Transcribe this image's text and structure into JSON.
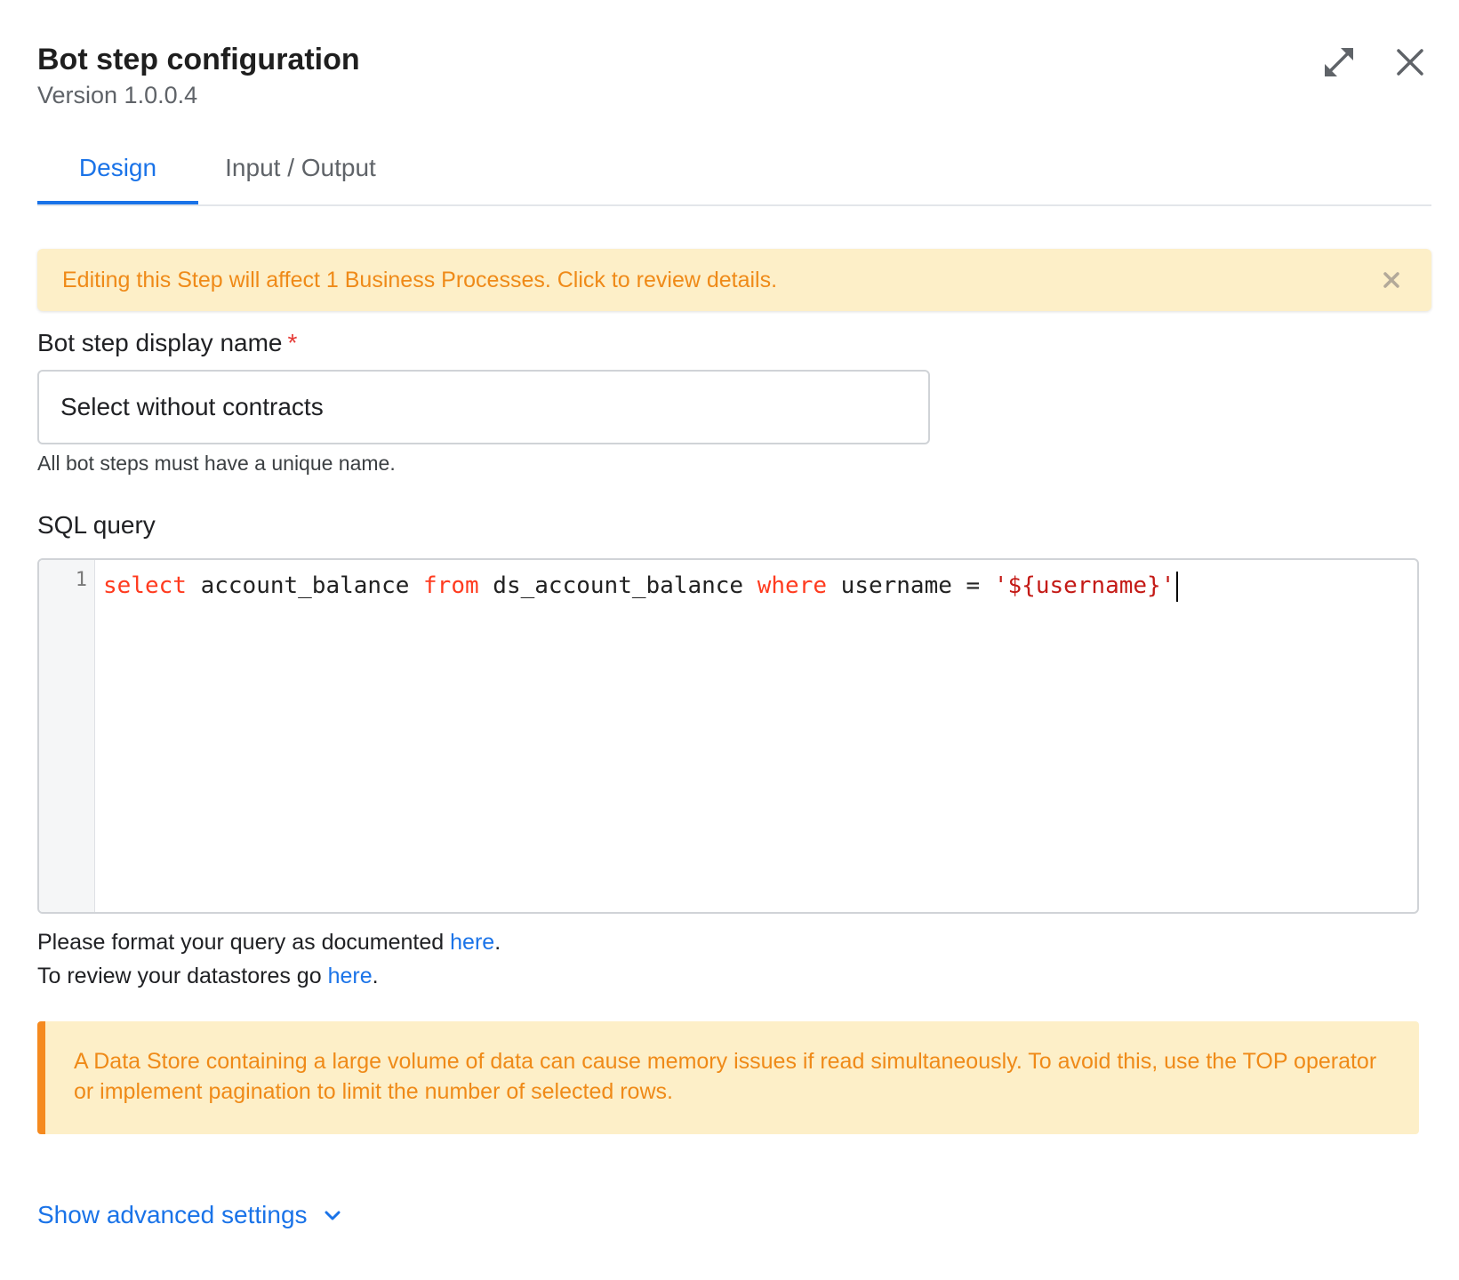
{
  "header": {
    "title": "Bot step configuration",
    "version": "Version 1.0.0.4",
    "expand_icon": "expand-icon",
    "close_icon": "close-icon"
  },
  "tabs": [
    {
      "label": "Design",
      "active": true
    },
    {
      "label": "Input / Output",
      "active": false
    }
  ],
  "top_alert": {
    "text": "Editing this Step will affect 1 Business Processes. Click to review details.",
    "close_icon": "close-icon"
  },
  "display_name": {
    "label": "Bot step display name",
    "required_marker": "*",
    "value": "Select without contracts",
    "hint": "All bot steps must have a unique name."
  },
  "sql": {
    "label": "SQL query",
    "line_number": "1",
    "tokens": {
      "kw_select": "select",
      "t1": " account_balance ",
      "kw_from": "from",
      "t2": " ds_account_balance ",
      "kw_where": "where",
      "t3": " username = ",
      "str": "'${username}'"
    }
  },
  "doc": {
    "line1_text": "Please format your query as documented ",
    "line1_link": "here",
    "line1_end": ".",
    "line2_text": "To review your datastores go ",
    "line2_link": "here",
    "line2_end": "."
  },
  "warning": {
    "text": "A Data Store containing a large volume of data can cause memory issues if read simultaneously. To avoid this, use the TOP operator or implement pagination to limit the number of selected rows."
  },
  "advanced": {
    "label": "Show advanced settings",
    "icon": "chevron-down-icon"
  },
  "colors": {
    "accent": "#1a73e8",
    "warning_text": "#ef8a18",
    "warning_bg": "#fdefc8",
    "warning_border": "#f58a1f",
    "sql_keyword": "#ff3b1f",
    "sql_string": "#c41a16"
  }
}
